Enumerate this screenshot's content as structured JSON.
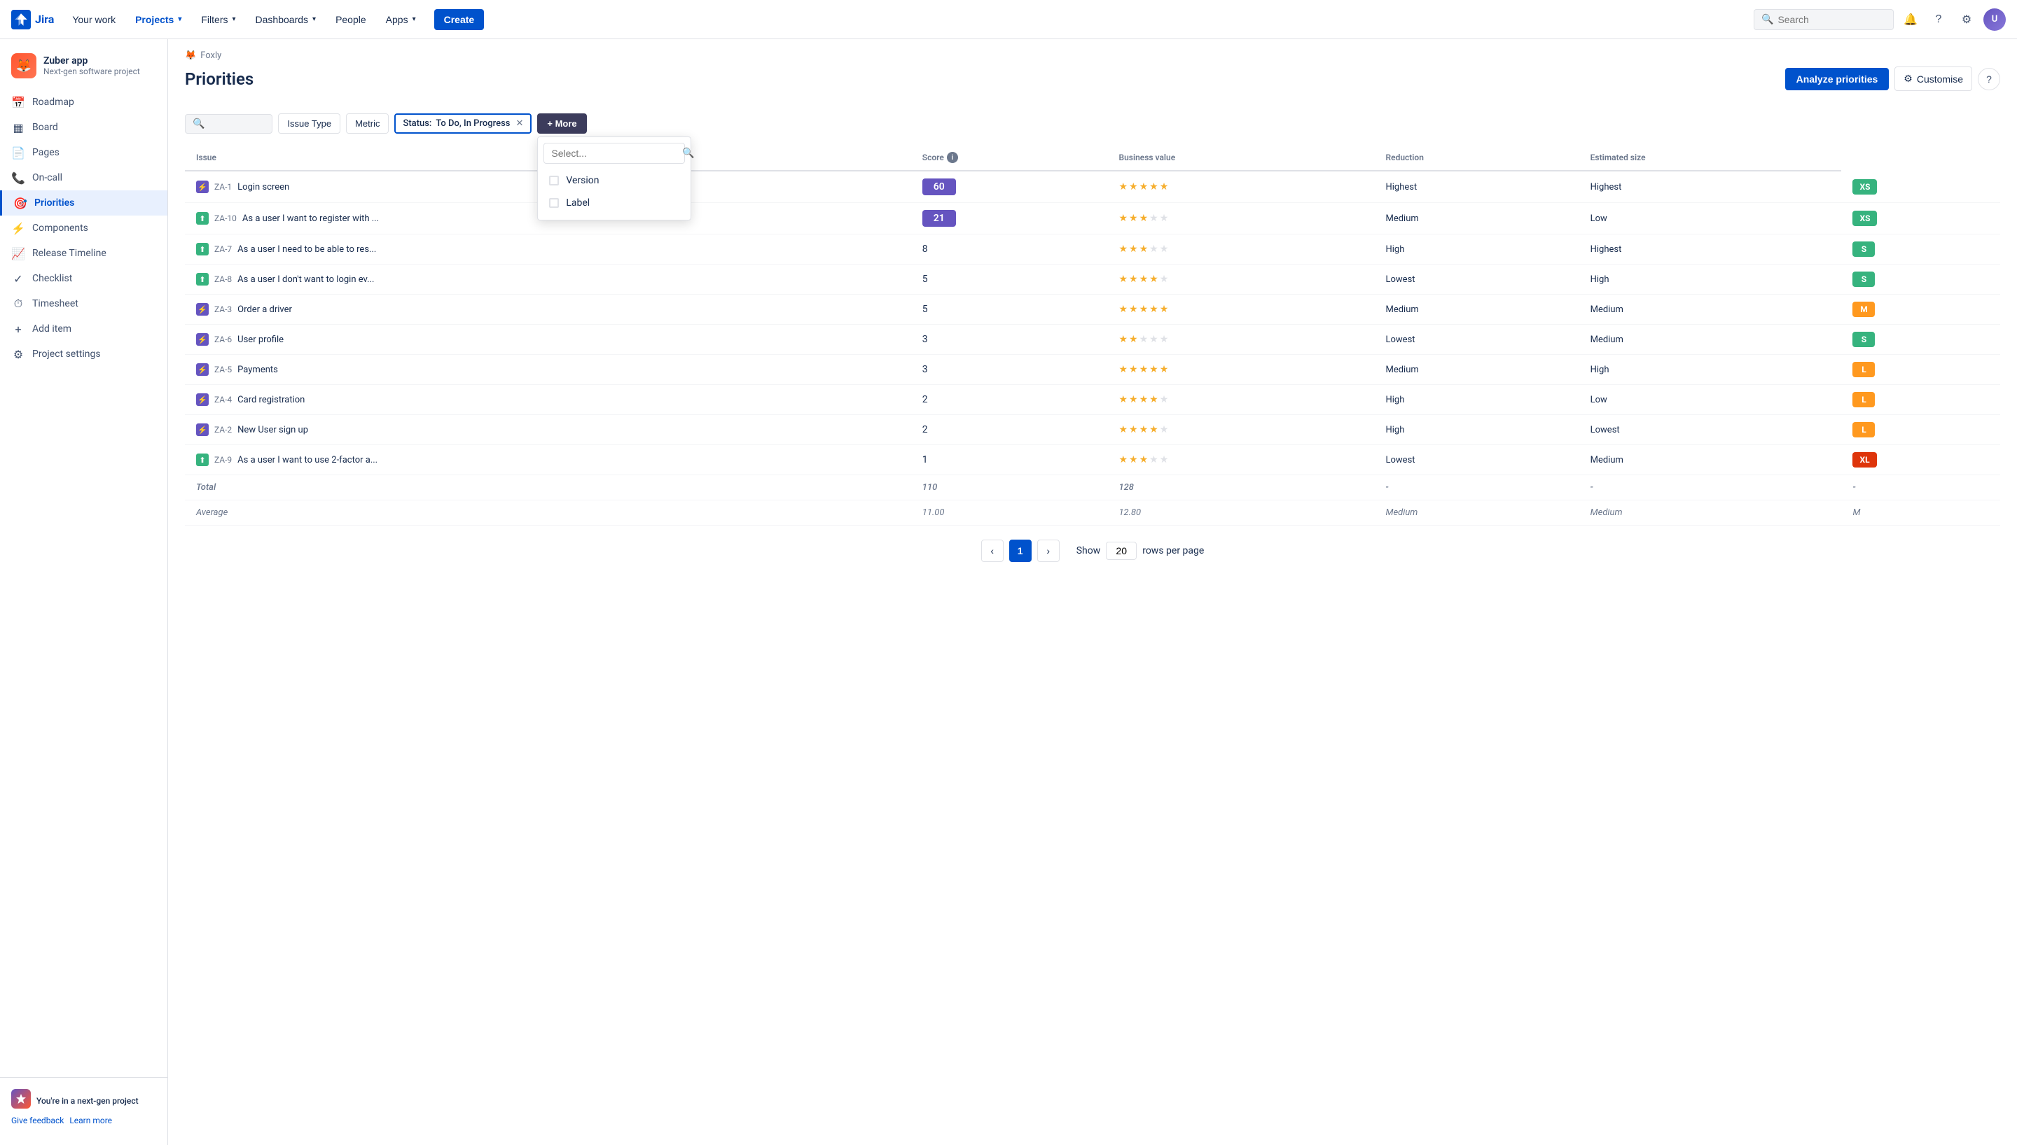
{
  "nav": {
    "logo_text": "Jira",
    "items": [
      {
        "label": "Your work",
        "active": false
      },
      {
        "label": "Projects",
        "active": true,
        "has_chevron": true
      },
      {
        "label": "Filters",
        "active": false,
        "has_chevron": true
      },
      {
        "label": "Dashboards",
        "active": false,
        "has_chevron": true
      },
      {
        "label": "People",
        "active": false
      },
      {
        "label": "Apps",
        "active": false,
        "has_chevron": true
      }
    ],
    "create_label": "Create",
    "search_placeholder": "Search"
  },
  "sidebar": {
    "project_name": "Zuber app",
    "project_type": "Next-gen software project",
    "items": [
      {
        "label": "Roadmap",
        "icon": "roadmap",
        "active": false
      },
      {
        "label": "Board",
        "icon": "board",
        "active": false
      },
      {
        "label": "Pages",
        "icon": "pages",
        "active": false
      },
      {
        "label": "On-call",
        "icon": "oncall",
        "active": false
      },
      {
        "label": "Priorities",
        "icon": "priorities",
        "active": true
      },
      {
        "label": "Components",
        "icon": "components",
        "active": false
      },
      {
        "label": "Release Timeline",
        "icon": "timeline",
        "active": false
      },
      {
        "label": "Checklist",
        "icon": "checklist",
        "active": false
      },
      {
        "label": "Timesheet",
        "icon": "timesheet",
        "active": false
      },
      {
        "label": "Add item",
        "icon": "add",
        "active": false
      },
      {
        "label": "Project settings",
        "icon": "settings",
        "active": false
      }
    ],
    "feedback_title": "You're in a next-gen project",
    "feedback_link1": "Give feedback",
    "feedback_link2": "Learn more"
  },
  "page": {
    "breadcrumb_project": "Foxly",
    "title": "Priorities",
    "btn_analyze": "Analyze priorities",
    "btn_customize": "Customise",
    "btn_help": "?",
    "filter_search_placeholder": "",
    "filter_issue_type": "Issue Type",
    "filter_metric": "Metric",
    "filter_status_label": "Status:",
    "filter_status_value": "To Do, In Progress",
    "btn_more": "+ More",
    "dropdown_search_placeholder": "Select...",
    "dropdown_items": [
      {
        "label": "Version"
      },
      {
        "label": "Label"
      }
    ]
  },
  "table": {
    "columns": [
      "Issue",
      "Score",
      "Business value",
      "Reduction",
      "Estimated size"
    ],
    "rows": [
      {
        "id": "ZA-1",
        "title": "Login screen",
        "icon_type": "epic",
        "score": 60,
        "score_highlighted": true,
        "business_value_stars": 5,
        "reduction": "Highest",
        "production": "Highest",
        "estimated_size": "XS",
        "size_color": "xs"
      },
      {
        "id": "ZA-10",
        "title": "As a user I want to register with ...",
        "icon_type": "story",
        "score": 21,
        "score_highlighted": true,
        "business_value_stars": 3,
        "reduction": "Medium",
        "production": "Low",
        "estimated_size": "XS",
        "size_color": "xs"
      },
      {
        "id": "ZA-7",
        "title": "As a user I need to be able to res...",
        "icon_type": "story",
        "score": 8,
        "score_highlighted": false,
        "business_value_stars": 3,
        "reduction": "High",
        "production": "Highest",
        "estimated_size": "S",
        "size_color": "s"
      },
      {
        "id": "ZA-8",
        "title": "As a user I don't want to login ev...",
        "icon_type": "story",
        "score": 5,
        "score_highlighted": false,
        "business_value_stars": 4,
        "reduction": "Lowest",
        "production": "High",
        "estimated_size": "S",
        "size_color": "s"
      },
      {
        "id": "ZA-3",
        "title": "Order a driver",
        "icon_type": "epic",
        "score": 5,
        "score_highlighted": false,
        "business_value_stars": 5,
        "reduction": "Medium",
        "production": "Medium",
        "estimated_size": "M",
        "size_color": "m"
      },
      {
        "id": "ZA-6",
        "title": "User profile",
        "icon_type": "epic",
        "score": 3,
        "score_highlighted": false,
        "business_value_stars": 2,
        "reduction": "Lowest",
        "production": "Medium",
        "estimated_size": "S",
        "size_color": "s"
      },
      {
        "id": "ZA-5",
        "title": "Payments",
        "icon_type": "epic",
        "score": 3,
        "score_highlighted": false,
        "business_value_stars": 5,
        "reduction": "Medium",
        "production": "High",
        "estimated_size": "L",
        "size_color": "l"
      },
      {
        "id": "ZA-4",
        "title": "Card registration",
        "icon_type": "epic",
        "score": 2,
        "score_highlighted": false,
        "business_value_stars": 4,
        "reduction": "High",
        "production": "Low",
        "estimated_size": "L",
        "size_color": "l"
      },
      {
        "id": "ZA-2",
        "title": "New User sign up",
        "icon_type": "epic",
        "score": 2,
        "score_highlighted": false,
        "business_value_stars": 4,
        "reduction": "High",
        "production": "Lowest",
        "estimated_size": "L",
        "size_color": "l"
      },
      {
        "id": "ZA-9",
        "title": "As a user I want to use 2-factor a...",
        "icon_type": "story",
        "score": 1,
        "score_highlighted": false,
        "business_value_stars": 3,
        "reduction": "Lowest",
        "production": "Medium",
        "estimated_size": "XL",
        "size_color": "xl"
      }
    ],
    "total_row": {
      "label": "Total",
      "score": "110",
      "business_value": "128",
      "reduction": "-",
      "production": "-",
      "estimated_size": "-"
    },
    "avg_row": {
      "label": "Average",
      "score": "11.00",
      "business_value": "12.80",
      "reduction": "Medium",
      "production": "Medium",
      "estimated_size": "M"
    }
  },
  "pagination": {
    "current_page": 1,
    "show_label": "Show",
    "rows_per_page": "20",
    "rows_per_page_label": "rows per page"
  }
}
